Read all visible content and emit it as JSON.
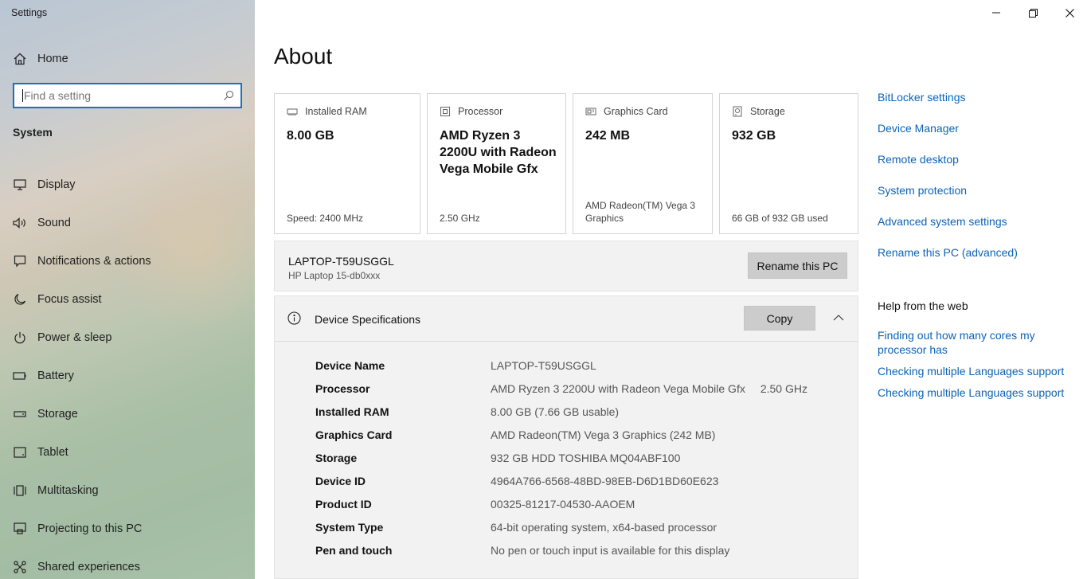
{
  "window": {
    "title": "Settings",
    "controls": {
      "minimize": "minimize-icon",
      "restore": "restore-icon",
      "close": "close-icon"
    }
  },
  "sidebar": {
    "home_label": "Home",
    "search_placeholder": "Find a setting",
    "section_label": "System",
    "items": [
      {
        "label": "Display",
        "icon": "display-icon"
      },
      {
        "label": "Sound",
        "icon": "speaker-icon"
      },
      {
        "label": "Notifications & actions",
        "icon": "message-icon"
      },
      {
        "label": "Focus assist",
        "icon": "moon-icon"
      },
      {
        "label": "Power & sleep",
        "icon": "power-icon"
      },
      {
        "label": "Battery",
        "icon": "battery-icon"
      },
      {
        "label": "Storage",
        "icon": "drive-icon"
      },
      {
        "label": "Tablet",
        "icon": "tablet-icon"
      },
      {
        "label": "Multitasking",
        "icon": "multitask-icon"
      },
      {
        "label": "Projecting to this PC",
        "icon": "project-icon"
      },
      {
        "label": "Shared experiences",
        "icon": "share-icon"
      }
    ]
  },
  "main": {
    "title": "About",
    "cards": [
      {
        "label": "Installed RAM",
        "value": "8.00 GB",
        "footer": "Speed: 2400 MHz",
        "icon": "ram-icon"
      },
      {
        "label": "Processor",
        "value": "AMD Ryzen 3 2200U with Radeon Vega Mobile Gfx",
        "footer": "2.50 GHz",
        "icon": "processor-icon"
      },
      {
        "label": "Graphics Card",
        "value": "242 MB",
        "footer": "AMD Radeon(TM) Vega 3 Graphics",
        "icon": "graphics-card-icon"
      },
      {
        "label": "Storage",
        "value": "932 GB",
        "footer": "66 GB of 932 GB used",
        "icon": "storage-icon"
      }
    ],
    "pc": {
      "name": "LAPTOP-T59USGGL",
      "model": "HP Laptop 15-db0xxx",
      "rename_label": "Rename this PC"
    },
    "specs": {
      "title": "Device Specifications",
      "copy_label": "Copy",
      "rows": [
        {
          "key": "Device Name",
          "value": "LAPTOP-T59USGGL",
          "extra": ""
        },
        {
          "key": "Processor",
          "value": "AMD Ryzen 3 2200U with Radeon Vega Mobile Gfx",
          "extra": "2.50 GHz"
        },
        {
          "key": "Installed RAM",
          "value": "8.00 GB (7.66 GB usable)",
          "extra": ""
        },
        {
          "key": "Graphics Card",
          "value": "AMD Radeon(TM) Vega 3 Graphics (242 MB)",
          "extra": ""
        },
        {
          "key": "Storage",
          "value": "932 GB HDD TOSHIBA MQ04ABF100",
          "extra": ""
        },
        {
          "key": "Device ID",
          "value": "4964A766-6568-48BD-98EB-D6D1BD60E623",
          "extra": ""
        },
        {
          "key": "Product ID",
          "value": "00325-81217-04530-AAOEM",
          "extra": ""
        },
        {
          "key": "System Type",
          "value": "64-bit operating system, x64-based processor",
          "extra": ""
        },
        {
          "key": "Pen and touch",
          "value": "No pen or touch input is available for this display",
          "extra": ""
        }
      ]
    }
  },
  "related": {
    "links": [
      "BitLocker settings",
      "Device Manager",
      "Remote desktop",
      "System protection",
      "Advanced system settings",
      "Rename this PC (advanced)"
    ],
    "help_title": "Help from the web",
    "help_links": [
      "Finding out how many cores my processor has",
      "Checking multiple Languages support",
      "Checking multiple Languages support"
    ]
  },
  "colors": {
    "accent": "#0b63b6",
    "search_border": "#1f6fbf",
    "button": "#cccccc",
    "panel": "#f2f2f2"
  }
}
